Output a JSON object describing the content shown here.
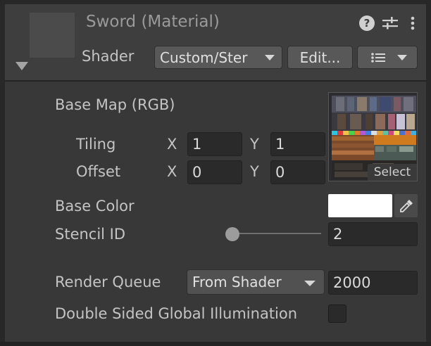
{
  "header": {
    "title": "Sword (Material)",
    "shader_label": "Shader",
    "shader_value": "Custom/Ster",
    "edit_label": "Edit...",
    "help_glyph": "?",
    "icons": [
      "help-icon",
      "presets-icon",
      "more-icon",
      "list-icon",
      "chevron-down-icon",
      "foldout-arrow-icon"
    ]
  },
  "properties": {
    "base_map": {
      "label": "Base Map (RGB)",
      "select_label": "Select"
    },
    "tiling": {
      "label": "Tiling",
      "x_label": "X",
      "x_value": "1",
      "y_label": "Y",
      "y_value": "1"
    },
    "offset": {
      "label": "Offset",
      "x_label": "X",
      "x_value": "0",
      "y_label": "Y",
      "y_value": "0"
    },
    "base_color": {
      "label": "Base Color",
      "color": "#ffffff"
    },
    "stencil_id": {
      "label": "Stencil ID",
      "value": "2"
    },
    "render_queue": {
      "label": "Render Queue",
      "mode": "From Shader",
      "value": "2000"
    },
    "double_sided_gi": {
      "label": "Double Sided Global Illumination",
      "checked": false
    }
  },
  "colors": {
    "panel_bg": "#383838",
    "header_bg": "#3e3e3e",
    "field_bg": "#2a2a2a",
    "button_bg": "#585858"
  }
}
